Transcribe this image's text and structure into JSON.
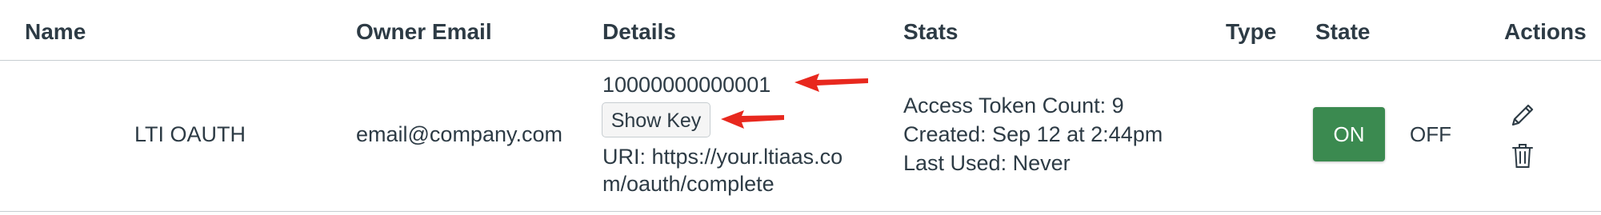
{
  "headers": {
    "name": "Name",
    "owner_email": "Owner Email",
    "details": "Details",
    "stats": "Stats",
    "type": "Type",
    "state": "State",
    "actions": "Actions"
  },
  "row": {
    "name": "LTI OAUTH",
    "owner_email": "email@company.com",
    "details": {
      "id": "10000000000001",
      "show_key_label": "Show Key",
      "uri_line1": "URI: https://your.ltiaas.co",
      "uri_line2": "m/oauth/complete"
    },
    "stats": {
      "access_token_count": "Access Token Count: 9",
      "created": "Created: Sep 12 at 2:44pm",
      "last_used": "Last Used: Never"
    },
    "state": {
      "on_label": "ON",
      "off_label": "OFF",
      "current": "on"
    },
    "actions": [
      "edit-icon",
      "trash-icon"
    ]
  },
  "colors": {
    "on_green": "#3b8a50",
    "annotation_arrow": "#e8281e",
    "text": "#2d3b45",
    "divider": "#c7cdd1"
  }
}
